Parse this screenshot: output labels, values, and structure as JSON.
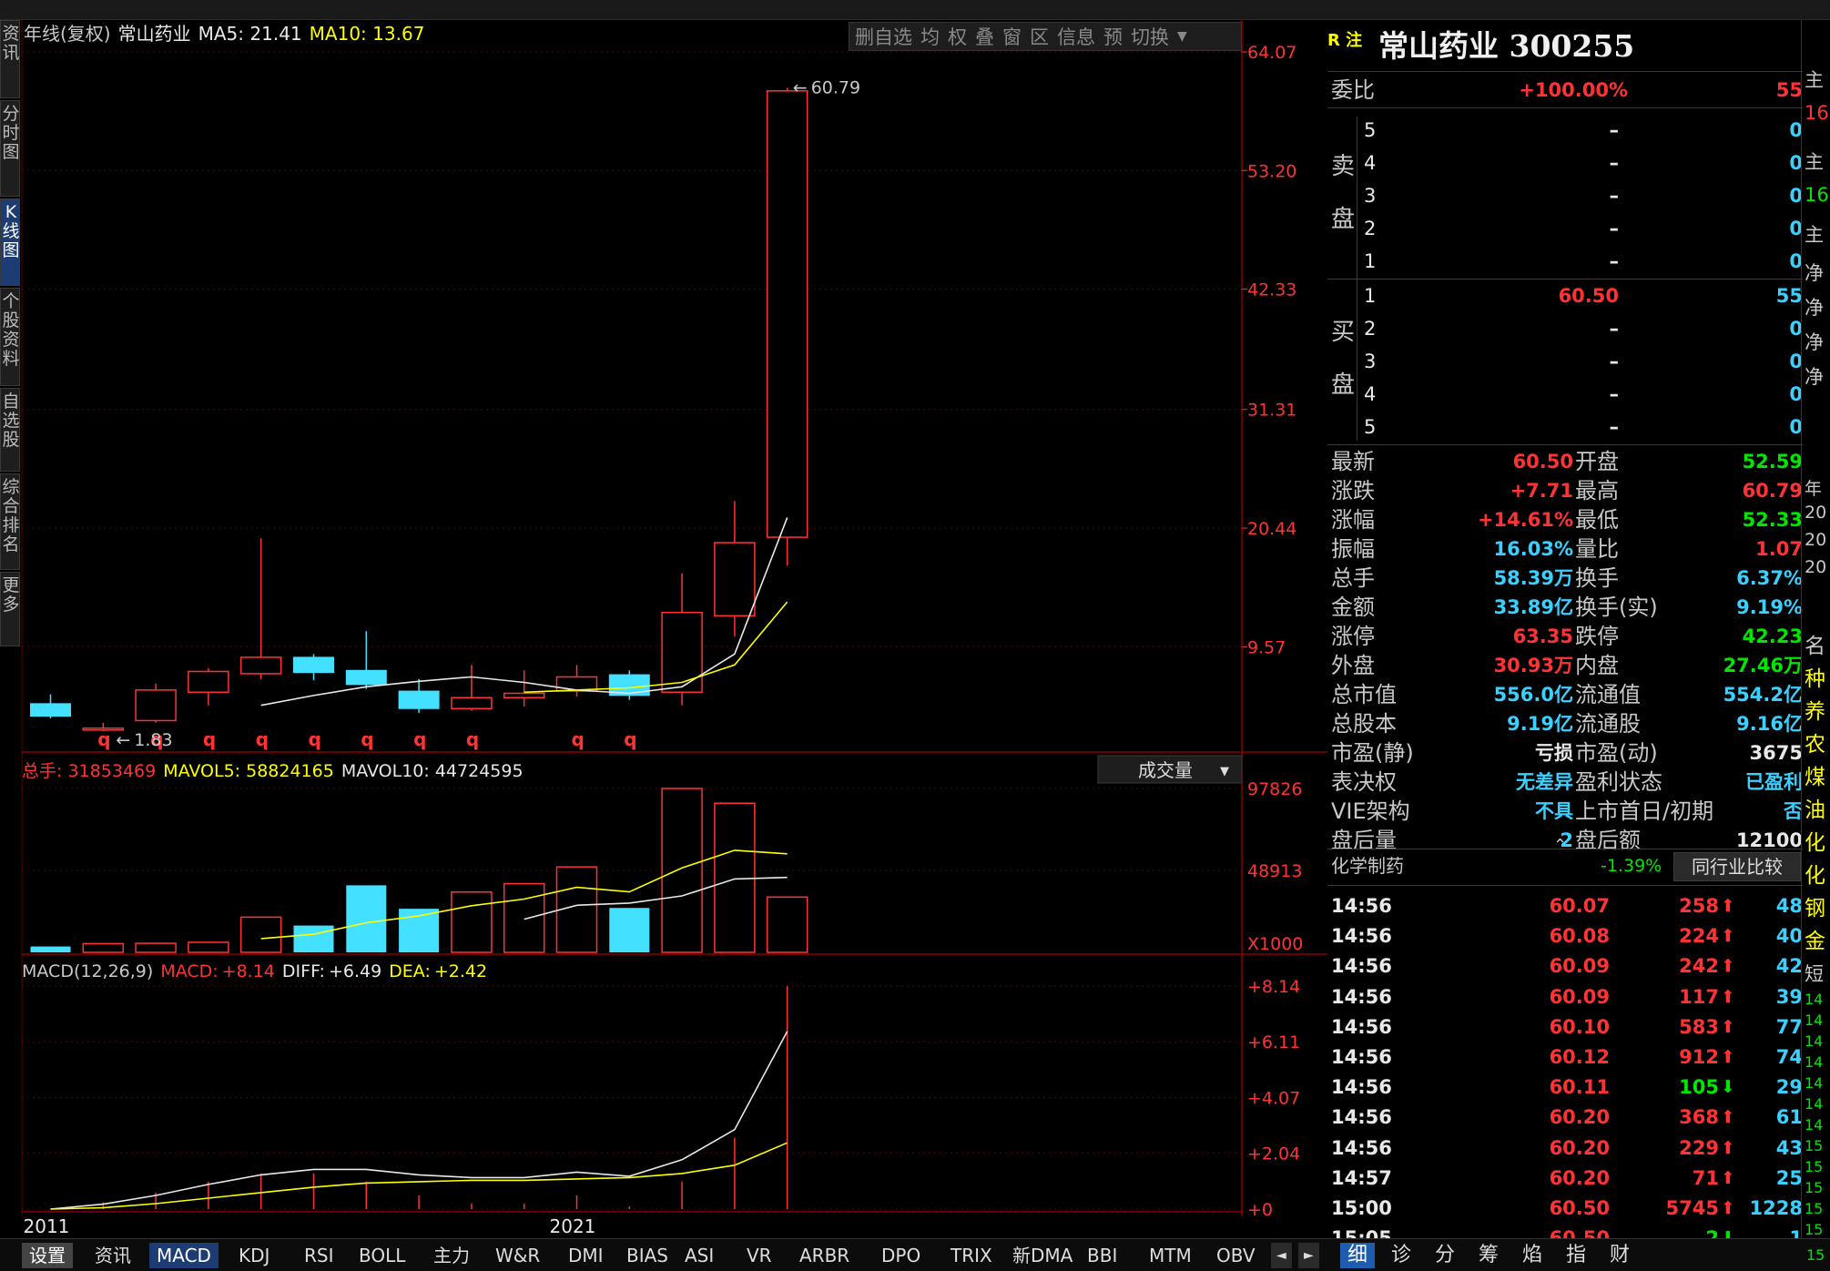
{
  "left_nav": [
    {
      "label": "资讯",
      "active": false
    },
    {
      "label": "分时图",
      "active": false
    },
    {
      "label": "K线图",
      "active": true
    },
    {
      "label": "个股资料",
      "active": false
    },
    {
      "label": "自选股",
      "active": false
    },
    {
      "label": "综合排名",
      "active": false
    },
    {
      "label": "更多",
      "active": false
    }
  ],
  "toolbar": [
    "删自选",
    "均",
    "权",
    "叠",
    "窗",
    "区",
    "信息",
    "预",
    "切换"
  ],
  "chart_data": [
    {
      "type": "candlestick",
      "title": "年线(复权)",
      "stock_label": "常山药业",
      "legend": [
        {
          "name": "MA5",
          "value": "21.41",
          "color": "#e8e8e8"
        },
        {
          "name": "MA10",
          "value": "13.67",
          "color": "#ffff00"
        }
      ],
      "ylim": [
        0,
        64.07
      ],
      "yticks": [
        "64.07",
        "53.20",
        "42.33",
        "31.31",
        "20.44",
        "9.57"
      ],
      "candles": [
        {
          "open": 4.35,
          "close": 3.2,
          "high": 5.2,
          "low": 3.0
        },
        {
          "open": 2.1,
          "close": 2.1,
          "high": 2.6,
          "low": 1.83
        },
        {
          "open": 2.8,
          "close": 5.6,
          "high": 6.2,
          "low": 2.6
        },
        {
          "open": 5.4,
          "close": 7.3,
          "high": 7.6,
          "low": 4.2
        },
        {
          "open": 7.1,
          "close": 8.6,
          "high": 19.5,
          "low": 6.6
        },
        {
          "open": 8.6,
          "close": 7.2,
          "high": 8.9,
          "low": 6.5
        },
        {
          "open": 7.4,
          "close": 6.1,
          "high": 11.0,
          "low": 5.7
        },
        {
          "open": 5.5,
          "close": 3.9,
          "high": 6.6,
          "low": 3.5
        },
        {
          "open": 3.9,
          "close": 4.9,
          "high": 7.9,
          "low": 3.7
        },
        {
          "open": 4.9,
          "close": 5.3,
          "high": 7.4,
          "low": 4.1
        },
        {
          "open": 5.5,
          "close": 6.8,
          "high": 7.9,
          "low": 5.0
        },
        {
          "open": 7.0,
          "close": 5.1,
          "high": 7.4,
          "low": 4.7
        },
        {
          "open": 5.4,
          "close": 12.7,
          "high": 16.3,
          "low": 4.2
        },
        {
          "open": 12.4,
          "close": 19.1,
          "high": 22.9,
          "low": 10.5
        },
        {
          "open": 19.6,
          "close": 60.5,
          "high": 60.79,
          "low": 17.0
        }
      ],
      "ma5": [
        null,
        null,
        null,
        null,
        4.2,
        5.1,
        5.9,
        6.4,
        6.8,
        6.3,
        5.6,
        5.3,
        5.9,
        8.9,
        21.41
      ],
      "ma10": [
        null,
        null,
        null,
        null,
        null,
        null,
        null,
        null,
        null,
        5.4,
        5.6,
        5.8,
        6.3,
        7.9,
        13.67
      ],
      "q_marks": [
        1,
        2,
        3,
        4,
        5,
        6,
        7,
        8,
        10,
        11
      ],
      "q_label": "q",
      "annotations": [
        {
          "index": 14,
          "text": "60.79"
        },
        {
          "index": 1,
          "text": "1.83"
        }
      ],
      "xticks": [
        {
          "index": 0,
          "label": "2011"
        },
        {
          "index": 10,
          "label": "2021"
        }
      ]
    },
    {
      "type": "bar",
      "legend": [
        {
          "name": "总手",
          "value": "31853469",
          "color": "#ff3333"
        },
        {
          "name": "MAVOL5",
          "value": "58824165",
          "color": "#ffff00"
        },
        {
          "name": "MAVOL10",
          "value": "44724595",
          "color": "#e8e8e8"
        }
      ],
      "selector_label": "成交量",
      "ylim": [
        0,
        97826
      ],
      "yticks": [
        "97826",
        "48913"
      ],
      "unit_label": "X1000",
      "values": [
        3500,
        5200,
        5400,
        6000,
        21000,
        16000,
        40000,
        26000,
        36000,
        41000,
        51000,
        26500,
        97826,
        89000,
        33000
      ],
      "rising": [
        false,
        true,
        true,
        true,
        true,
        false,
        false,
        false,
        true,
        true,
        true,
        false,
        true,
        true,
        true
      ],
      "mavol5": [
        null,
        null,
        null,
        null,
        8200,
        10760,
        17680,
        21800,
        27800,
        31800,
        38800,
        36100,
        50400,
        60900,
        58824
      ],
      "mavol10": [
        null,
        null,
        null,
        null,
        null,
        null,
        null,
        null,
        null,
        19800,
        28100,
        29400,
        33700,
        43800,
        44724
      ]
    },
    {
      "type": "line",
      "legend": [
        {
          "name": "MACD(12,26,9)",
          "value": "",
          "color": "#c8c8c8"
        },
        {
          "name": "MACD:",
          "value": "+8.14",
          "color": "#ff3333"
        },
        {
          "name": "DIFF:",
          "value": "+6.49",
          "color": "#e8e8e8"
        },
        {
          "name": "DEA:",
          "value": "+2.42",
          "color": "#ffff00"
        }
      ],
      "ylim": [
        0,
        8.14
      ],
      "yticks": [
        "+8.14",
        "+6.11",
        "+4.07",
        "+2.04",
        "+0"
      ],
      "diff": [
        0.0,
        0.18,
        0.5,
        0.9,
        1.25,
        1.45,
        1.45,
        1.25,
        1.15,
        1.15,
        1.35,
        1.2,
        1.8,
        2.9,
        6.49
      ],
      "dea": [
        0.0,
        0.05,
        0.2,
        0.4,
        0.6,
        0.8,
        0.95,
        1.0,
        1.05,
        1.05,
        1.1,
        1.15,
        1.3,
        1.6,
        2.42
      ],
      "macd": [
        0.0,
        0.25,
        0.6,
        1.0,
        1.3,
        1.3,
        1.0,
        0.5,
        0.2,
        0.2,
        0.5,
        0.1,
        1.0,
        2.6,
        8.14
      ]
    }
  ],
  "quote": {
    "badge": "R 注",
    "title": "常山药业 300255",
    "weibi_label": "委比",
    "weibi_value": "+100.00%",
    "weibi_count": "55",
    "sell_label": [
      "卖",
      "盘"
    ],
    "buy_label": [
      "买",
      "盘"
    ],
    "sell": [
      {
        "level": "5",
        "price": "–",
        "vol": "0"
      },
      {
        "level": "4",
        "price": "–",
        "vol": "0"
      },
      {
        "level": "3",
        "price": "–",
        "vol": "0"
      },
      {
        "level": "2",
        "price": "–",
        "vol": "0"
      },
      {
        "level": "1",
        "price": "–",
        "vol": "0"
      }
    ],
    "buy": [
      {
        "level": "1",
        "price": "60.50",
        "vol": "55"
      },
      {
        "level": "2",
        "price": "–",
        "vol": "0"
      },
      {
        "level": "3",
        "price": "–",
        "vol": "0"
      },
      {
        "level": "4",
        "price": "–",
        "vol": "0"
      },
      {
        "level": "5",
        "price": "–",
        "vol": "0"
      }
    ],
    "stats": [
      {
        "l1": "最新",
        "v1": "60.50",
        "c1": "red",
        "l2": "开盘",
        "v2": "52.59",
        "c2": "green"
      },
      {
        "l1": "涨跌",
        "v1": "+7.71",
        "c1": "red",
        "l2": "最高",
        "v2": "60.79",
        "c2": "red"
      },
      {
        "l1": "涨幅",
        "v1": "+14.61%",
        "c1": "red",
        "l2": "最低",
        "v2": "52.33",
        "c2": "green"
      },
      {
        "l1": "振幅",
        "v1": "16.03%",
        "c1": "cyan",
        "l2": "量比",
        "v2": "1.07",
        "c2": "red"
      },
      {
        "l1": "总手",
        "v1": "58.39万",
        "c1": "cyan",
        "l2": "换手",
        "v2": "6.37%",
        "c2": "cyan"
      },
      {
        "l1": "金额",
        "v1": "33.89亿",
        "c1": "cyan",
        "l2": "换手(实)",
        "v2": "9.19%",
        "c2": "cyan"
      },
      {
        "l1": "涨停",
        "v1": "63.35",
        "c1": "red",
        "l2": "跌停",
        "v2": "42.23",
        "c2": "green"
      },
      {
        "l1": "外盘",
        "v1": "30.93万",
        "c1": "red",
        "l2": "内盘",
        "v2": "27.46万",
        "c2": "green"
      },
      {
        "l1": "总市值",
        "v1": "556.0亿",
        "c1": "cyan",
        "l2": "流通值",
        "v2": "554.2亿",
        "c2": "cyan"
      },
      {
        "l1": "总股本",
        "v1": "9.19亿",
        "c1": "cyan",
        "l2": "流通股",
        "v2": "9.16亿",
        "c2": "cyan"
      },
      {
        "l1": "市盈(静)",
        "v1": "亏损",
        "c1": "white",
        "l2": "市盈(动)",
        "v2": "3675",
        "c2": "white"
      },
      {
        "l1": "表决权",
        "v1": "无差异",
        "c1": "cyan",
        "l2": "盈利状态",
        "v2": "已盈利",
        "c2": "cyan"
      },
      {
        "l1": "VIE架构",
        "v1": "不具",
        "c1": "cyan",
        "l2": "上市首日/初期",
        "v2": "否",
        "c2": "cyan"
      },
      {
        "l1": "盘后量",
        "v1": "2",
        "c1": "cyan",
        "l2": "盘后额",
        "v2": "12100",
        "c2": "white"
      }
    ],
    "sector_name": "化学制药",
    "sector_change": "-1.39%",
    "compare_button": "同行业比较"
  },
  "ticks": [
    {
      "time": "14:56",
      "price": "60.07",
      "vol": "258",
      "dir": "up",
      "cnt": "48"
    },
    {
      "time": "14:56",
      "price": "60.08",
      "vol": "224",
      "dir": "up",
      "cnt": "40"
    },
    {
      "time": "14:56",
      "price": "60.09",
      "vol": "242",
      "dir": "up",
      "cnt": "42"
    },
    {
      "time": "14:56",
      "price": "60.09",
      "vol": "117",
      "dir": "up",
      "cnt": "39"
    },
    {
      "time": "14:56",
      "price": "60.10",
      "vol": "583",
      "dir": "up",
      "cnt": "77"
    },
    {
      "time": "14:56",
      "price": "60.12",
      "vol": "912",
      "dir": "up",
      "cnt": "74"
    },
    {
      "time": "14:56",
      "price": "60.11",
      "vol": "105",
      "dir": "down",
      "cnt": "29"
    },
    {
      "time": "14:56",
      "price": "60.20",
      "vol": "368",
      "dir": "up",
      "cnt": "61"
    },
    {
      "time": "14:56",
      "price": "60.20",
      "vol": "229",
      "dir": "up",
      "cnt": "43"
    },
    {
      "time": "14:57",
      "price": "60.20",
      "vol": "71",
      "dir": "up",
      "cnt": "25"
    },
    {
      "time": "15:00",
      "price": "60.50",
      "vol": "5745",
      "dir": "up",
      "cnt": "1228"
    },
    {
      "time": "15:05",
      "price": "60.50",
      "vol": "2",
      "dir": "down",
      "cnt": "1"
    }
  ],
  "edge_right": {
    "top": [
      {
        "text": "主",
        "color": "#c8c8c8"
      },
      {
        "text": "16",
        "color": "#ff3333"
      },
      {
        "text": "主",
        "color": "#c8c8c8"
      },
      {
        "text": "16",
        "color": "#00e600"
      },
      {
        "text": "主",
        "color": "#c8c8c8"
      },
      {
        "text": "净",
        "color": "#c8c8c8"
      },
      {
        "text": "净",
        "color": "#c8c8c8"
      },
      {
        "text": "净",
        "color": "#c8c8c8"
      },
      {
        "text": "净",
        "color": "#c8c8c8"
      }
    ],
    "mid": [
      "年",
      "20",
      "20",
      "20"
    ],
    "list": [
      {
        "text": "名",
        "color": "#c8c8c8"
      },
      {
        "text": "种",
        "color": "#ffff00"
      },
      {
        "text": "养",
        "color": "#ffff00"
      },
      {
        "text": "农",
        "color": "#ffff00"
      },
      {
        "text": "煤",
        "color": "#ffff00"
      },
      {
        "text": "油",
        "color": "#ffff00"
      },
      {
        "text": "化",
        "color": "#ffff00"
      },
      {
        "text": "化",
        "color": "#ffff00"
      },
      {
        "text": "钢",
        "color": "#ffff00"
      },
      {
        "text": "金",
        "color": "#ffff00"
      }
    ],
    "short_label": "短",
    "nums": [
      "14",
      "14",
      "14",
      "14",
      "14",
      "14",
      "14",
      "15",
      "15",
      "15",
      "15",
      "15"
    ]
  },
  "bottom_tabs": [
    {
      "label": "设置",
      "state": "first"
    },
    {
      "label": "资讯",
      "state": ""
    },
    {
      "label": "MACD",
      "state": "active"
    },
    {
      "label": "KDJ",
      "state": ""
    },
    {
      "label": "RSI",
      "state": ""
    },
    {
      "label": "BOLL",
      "state": ""
    },
    {
      "label": "主力",
      "state": ""
    },
    {
      "label": "W&R",
      "state": ""
    },
    {
      "label": "DMI",
      "state": ""
    },
    {
      "label": "BIAS",
      "state": ""
    },
    {
      "label": "ASI",
      "state": ""
    },
    {
      "label": "VR",
      "state": ""
    },
    {
      "label": "ARBR",
      "state": ""
    },
    {
      "label": "DPO",
      "state": ""
    },
    {
      "label": "TRIX",
      "state": ""
    },
    {
      "label": "新DMA",
      "state": ""
    },
    {
      "label": "BBI",
      "state": ""
    },
    {
      "label": "MTM",
      "state": ""
    },
    {
      "label": "OBV",
      "state": ""
    }
  ],
  "nav_arrows": [
    "◄",
    "►"
  ],
  "tick_tabs": [
    {
      "label": "细",
      "active": true
    },
    {
      "label": "诊",
      "active": false
    },
    {
      "label": "分",
      "active": false
    },
    {
      "label": "筹",
      "active": false
    },
    {
      "label": "焰",
      "active": false
    },
    {
      "label": "指",
      "active": false
    },
    {
      "label": "财",
      "active": false
    }
  ],
  "bottom_right_num": "15"
}
